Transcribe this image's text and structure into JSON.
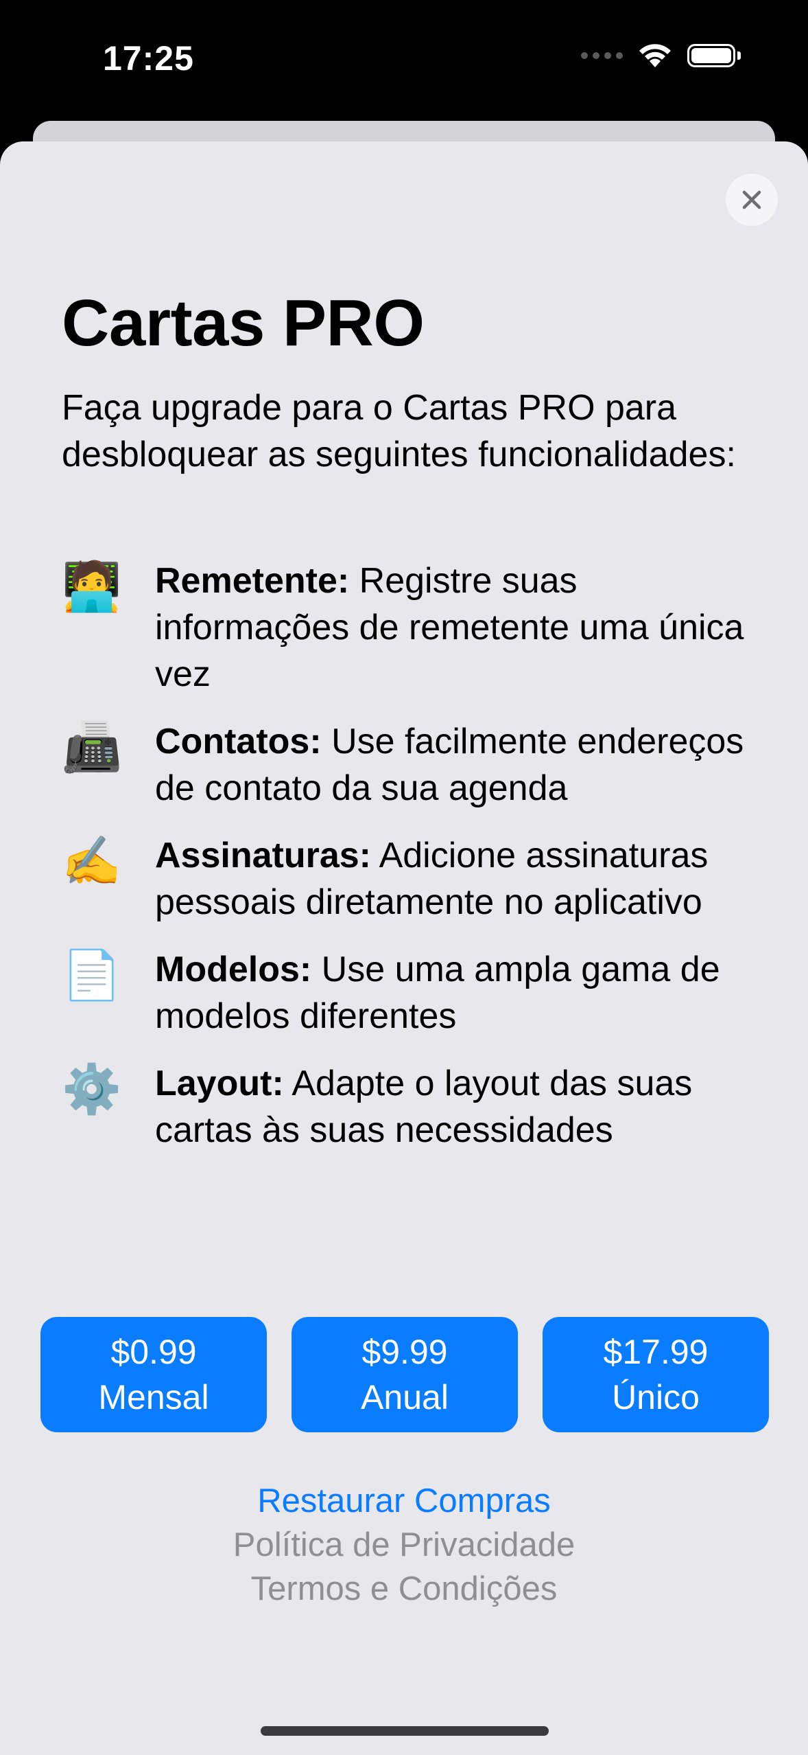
{
  "status_bar": {
    "time": "17:25"
  },
  "close_icon": "close-icon",
  "title": "Cartas PRO",
  "intro": "Faça upgrade para o Cartas PRO para desbloquear as seguintes funcionalidades:",
  "features": [
    {
      "icon": "🧑‍💻",
      "title": "Remetente:",
      "description": "Registre suas informações de remetente uma única vez"
    },
    {
      "icon": "📠",
      "title": "Contatos:",
      "description": "Use facilmente endereços de contato da sua agenda"
    },
    {
      "icon": "✍️",
      "title": "Assinaturas:",
      "description": "Adicione assinaturas pessoais diretamente no aplicativo"
    },
    {
      "icon": "📄",
      "title": "Modelos:",
      "description": "Use uma ampla gama de modelos diferentes"
    },
    {
      "icon": "⚙️",
      "title": "Layout:",
      "description": "Adapte o layout das suas cartas às suas necessidades"
    }
  ],
  "plans": [
    {
      "price": "$0.99",
      "period": "Mensal"
    },
    {
      "price": "$9.99",
      "period": "Anual"
    },
    {
      "price": "$17.99",
      "period": "Único"
    }
  ],
  "links": {
    "restore": "Restaurar Compras",
    "privacy": "Política de Privacidade",
    "terms": "Termos e Condições"
  },
  "colors": {
    "accent": "#0a7cff",
    "sheet_background": "#e7e7ec",
    "secondary_text": "#8e8e93"
  }
}
